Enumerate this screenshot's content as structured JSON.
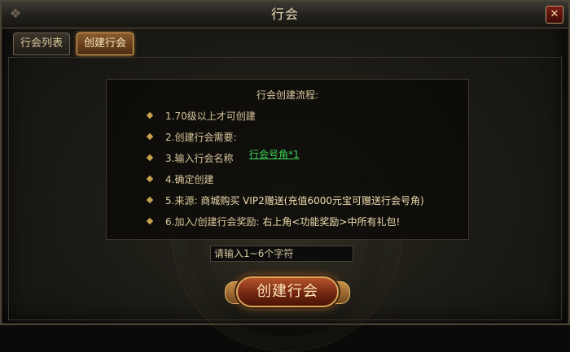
{
  "window": {
    "title": "行会",
    "close_label": "✕"
  },
  "tabs": [
    {
      "label": "行会列表",
      "active": false
    },
    {
      "label": "创建行会",
      "active": true
    }
  ],
  "info": {
    "heading": "行会创建流程:",
    "steps": [
      {
        "text": "1.70级以上才可创建"
      },
      {
        "text": "2.创建行会需要:",
        "link": "行会号角*1"
      },
      {
        "text": "3.输入行会名称"
      },
      {
        "text": "4.确定创建"
      },
      {
        "prefix": "5.来源:",
        "highlight": "商城购买 VIP2赠送(充值6000元宝可赠送行会号角)"
      },
      {
        "prefix": "6.加入/创建行会奖励:",
        "highlight": "右上角<功能奖励>中所有礼包!"
      }
    ]
  },
  "name_input": {
    "placeholder": "请输入1~6个字符",
    "value": ""
  },
  "create_button": {
    "label": "创建行会"
  },
  "colors": {
    "accent": "#d9a35b",
    "link": "#3ad35a",
    "text": "#d8c79d",
    "button": "#6e2410"
  }
}
